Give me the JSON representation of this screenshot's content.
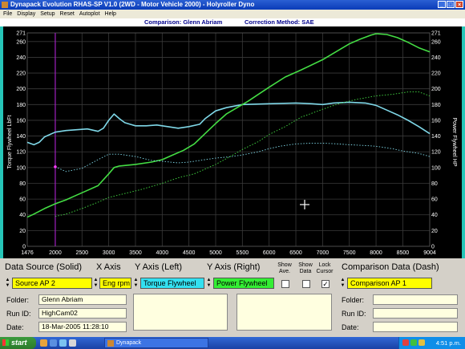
{
  "window": {
    "title": "Dynapack Evolution RHAS-SP V1.0  (2WD - Motor Vehicle 2000) - Holyroller Dyno"
  },
  "menu": [
    "File",
    "Display",
    "Setup",
    "Reset",
    "Autoplot",
    "Help"
  ],
  "info": {
    "comparison": "Comparison: Glenn Abriam",
    "correction": "Correction Method: SAE"
  },
  "chart_data": {
    "type": "line",
    "xlim": [
      1476,
      9004
    ],
    "x_ticks": [
      "1476",
      "2000",
      "2500",
      "3000",
      "3500",
      "4000",
      "4500",
      "5000",
      "5500",
      "6000",
      "6500",
      "7000",
      "7500",
      "8000",
      "8500",
      "9004"
    ],
    "y_left": {
      "label": "Torque Flywheel LbFt",
      "ylim": [
        0,
        271
      ],
      "ticks": [
        "0",
        "20",
        "40",
        "60",
        "80",
        "100",
        "120",
        "140",
        "160",
        "180",
        "200",
        "220",
        "240",
        "260",
        "271"
      ]
    },
    "y_right": {
      "label": "Power Flywheel HP",
      "ylim": [
        0,
        271
      ],
      "ticks": [
        "0",
        "20",
        "40",
        "60",
        "80",
        "100",
        "120",
        "140",
        "160",
        "180",
        "200",
        "220",
        "240",
        "260",
        "271"
      ]
    },
    "grid": true,
    "cursor_x": 2000,
    "series": [
      {
        "name": "Torque Flywheel",
        "style": "solid",
        "color": "#7fd8e8",
        "x": [
          1476,
          1600,
          1700,
          1800,
          1900,
          2000,
          2200,
          2400,
          2600,
          2800,
          2900,
          3000,
          3100,
          3200,
          3300,
          3400,
          3500,
          3700,
          3900,
          4100,
          4300,
          4500,
          4700,
          4800,
          5000,
          5200,
          5500,
          6000,
          6500,
          6800,
          7000,
          7200,
          7500,
          7800,
          8000,
          8200,
          8400,
          8600,
          8800,
          9004
        ],
        "y": [
          132,
          129,
          132,
          139,
          142,
          145,
          147,
          148,
          149,
          146,
          150,
          160,
          168,
          162,
          157,
          155,
          153,
          153,
          154,
          152,
          150,
          152,
          155,
          162,
          172,
          176,
          180,
          181,
          182,
          181,
          180,
          182,
          183,
          182,
          179,
          173,
          167,
          160,
          152,
          143
        ]
      },
      {
        "name": "Power Flywheel",
        "style": "solid",
        "color": "#44dd44",
        "x": [
          1476,
          1600,
          1800,
          2000,
          2200,
          2400,
          2600,
          2800,
          3000,
          3100,
          3200,
          3500,
          3800,
          4000,
          4200,
          4400,
          4600,
          4800,
          5000,
          5200,
          5400,
          5600,
          5800,
          6000,
          6300,
          6600,
          7000,
          7300,
          7500,
          7700,
          7900,
          8000,
          8200,
          8400,
          8600,
          8800,
          9004
        ],
        "y": [
          37,
          41,
          48,
          54,
          59,
          65,
          71,
          77,
          92,
          100,
          102,
          104,
          107,
          110,
          116,
          122,
          130,
          143,
          156,
          168,
          176,
          184,
          193,
          202,
          215,
          224,
          237,
          249,
          257,
          263,
          268,
          270,
          269,
          265,
          259,
          252,
          247
        ]
      },
      {
        "name": "Torque Flywheel (Comparison AP 1)",
        "style": "dash",
        "color": "#7fd8e8",
        "x": [
          2000,
          2200,
          2500,
          2800,
          3000,
          3200,
          3500,
          3800,
          4000,
          4300,
          4500,
          4800,
          5000,
          5300,
          5500,
          5800,
          6000,
          6200,
          6500,
          6800,
          7000,
          7300,
          7500,
          7800,
          8000,
          8300,
          8500,
          8800,
          9004
        ],
        "y": [
          101,
          95,
          99,
          110,
          117,
          117,
          114,
          109,
          108,
          106,
          107,
          110,
          112,
          114,
          116,
          120,
          124,
          127,
          130,
          131,
          131,
          130,
          129,
          128,
          127,
          124,
          121,
          118,
          114
        ]
      },
      {
        "name": "Power Flywheel (Comparison AP 1)",
        "style": "dash",
        "color": "#44dd44",
        "x": [
          2000,
          2200,
          2500,
          2800,
          3000,
          3300,
          3600,
          4000,
          4300,
          4600,
          5000,
          5300,
          5500,
          5800,
          6000,
          6300,
          6600,
          7000,
          7300,
          7600,
          8000,
          8300,
          8600,
          8800,
          9004
        ],
        "y": [
          38,
          41,
          48,
          56,
          62,
          67,
          72,
          80,
          87,
          92,
          104,
          115,
          123,
          133,
          142,
          152,
          164,
          174,
          181,
          186,
          191,
          193,
          196,
          196,
          191
        ]
      }
    ]
  },
  "panel": {
    "headers": {
      "data_source": "Data Source (Solid)",
      "x_axis": "X Axis",
      "y_left": "Y Axis (Left)",
      "y_right": "Y Axis (Right)",
      "comparison": "Comparison Data (Dash)"
    },
    "show_ave": "Show Ave.",
    "show_data": "Show Data",
    "lock_cursor": "Lock Cursor",
    "source_select": "Source AP 2",
    "x_axis_select": "Eng rpm",
    "y_left_select": "Torque Flywheel",
    "y_right_select": "Power Flywheel",
    "comparison_select": "Comparison AP 1",
    "show_ave_checked": false,
    "show_data_checked": false,
    "lock_cursor_checked": true,
    "check_mark": "✓",
    "left_labels": {
      "folder": "Folder:",
      "run_id": "Run ID:",
      "date": "Date:"
    },
    "left_values": {
      "folder": "Glenn Abriam",
      "run_id": "HighCam02",
      "date": "18-Mar-2005  11:28:10"
    },
    "right_labels": {
      "folder": "Folder:",
      "run_id": "Run ID:",
      "date": "Date:"
    },
    "right_values": {
      "folder": "",
      "run_id": "",
      "date": ""
    }
  },
  "taskbar": {
    "start": "start",
    "task": "Dynapack",
    "time": "4:51 p.m."
  }
}
